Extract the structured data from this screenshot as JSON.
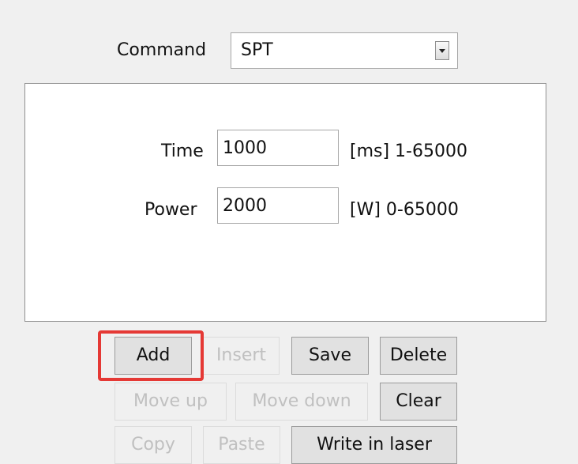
{
  "command": {
    "label": "Command",
    "value": "SPT",
    "dropdown_icon": "chevron-down-icon"
  },
  "parameters": {
    "time": {
      "label": "Time",
      "value": "1000",
      "range": "[ms] 1-65000"
    },
    "power": {
      "label": "Power",
      "value": "2000",
      "range": "[W] 0-65000"
    }
  },
  "buttons": {
    "add": "Add",
    "insert": "Insert",
    "save": "Save",
    "delete": "Delete",
    "move_up": "Move up",
    "move_down": "Move down",
    "clear": "Clear",
    "copy": "Copy",
    "paste": "Paste",
    "write_in_laser": "Write in laser"
  },
  "highlight_color": "#e53935"
}
